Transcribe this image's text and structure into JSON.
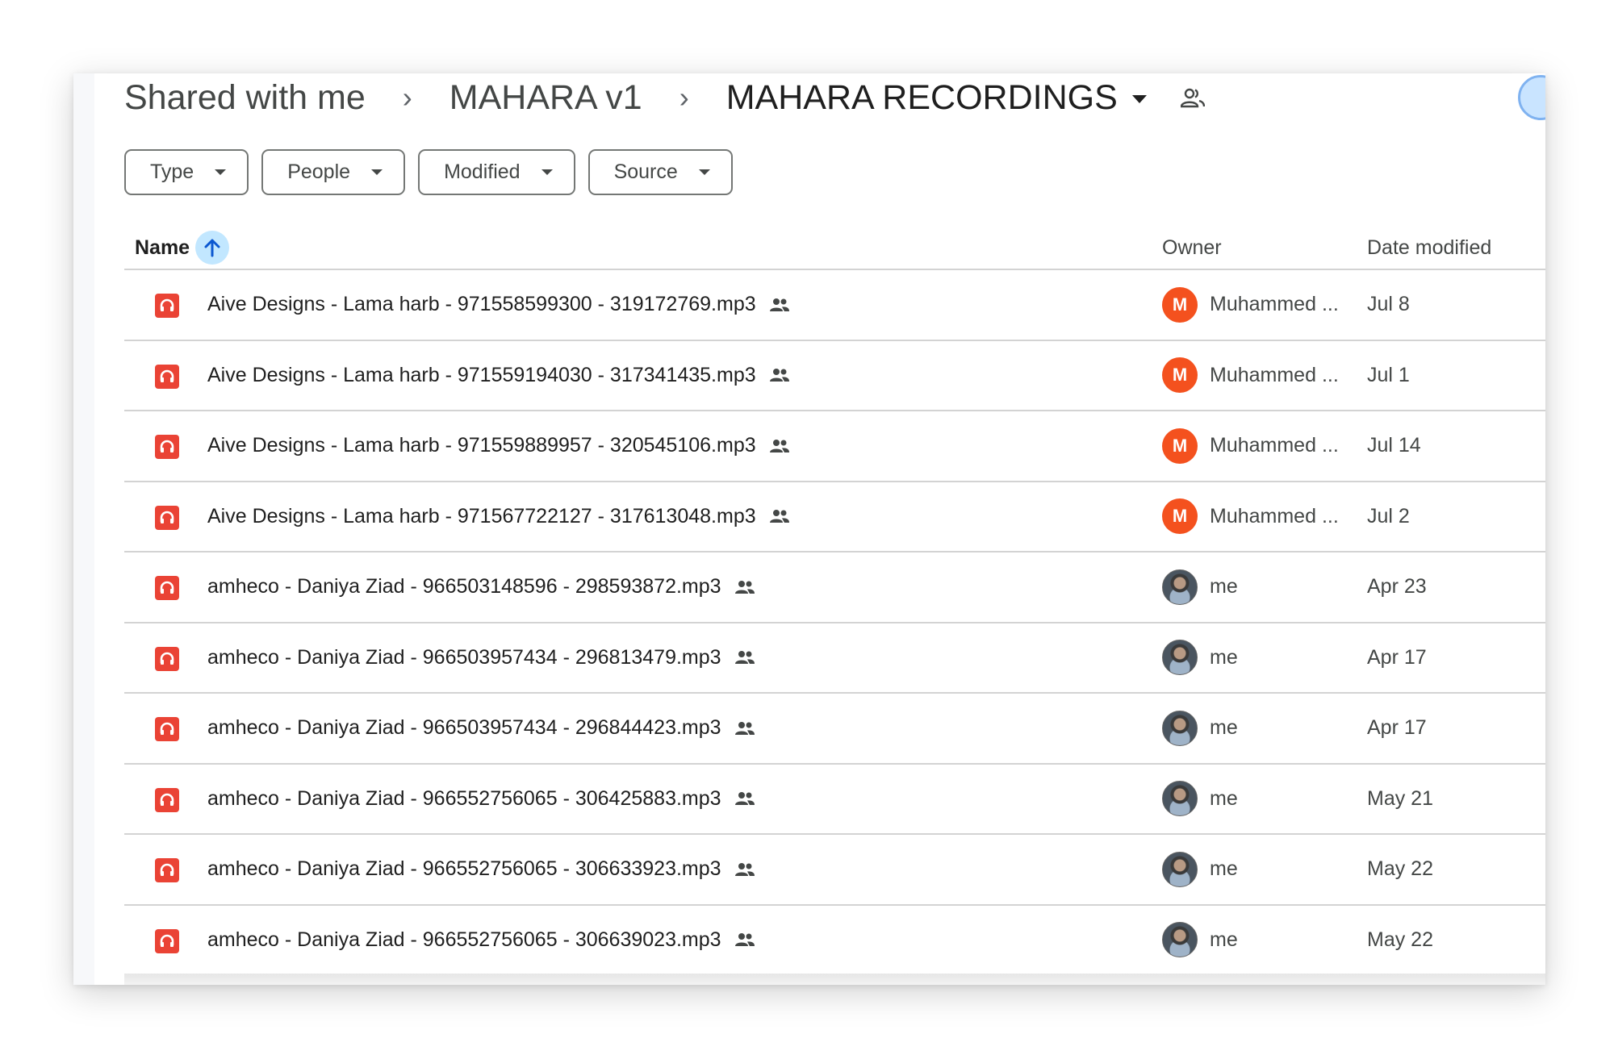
{
  "breadcrumb": {
    "items": [
      "Shared with me",
      "MAHARA v1",
      "MAHARA RECORDINGS"
    ],
    "separator": "›"
  },
  "filters": [
    "Type",
    "People",
    "Modified",
    "Source"
  ],
  "table": {
    "columns": {
      "name": "Name",
      "owner": "Owner",
      "date": "Date modified"
    },
    "sort": "ascending",
    "rows": [
      {
        "name": "Aive Designs - Lama harb - 971558599300 - 319172769.mp3",
        "owner": "Muhammed ...",
        "owner_initial": "M",
        "avatar": "letter",
        "date": "Jul 8"
      },
      {
        "name": "Aive Designs - Lama harb - 971559194030 - 317341435.mp3",
        "owner": "Muhammed ...",
        "owner_initial": "M",
        "avatar": "letter",
        "date": "Jul 1"
      },
      {
        "name": "Aive Designs - Lama harb - 971559889957 - 320545106.mp3",
        "owner": "Muhammed ...",
        "owner_initial": "M",
        "avatar": "letter",
        "date": "Jul 14"
      },
      {
        "name": "Aive Designs - Lama harb - 971567722127 - 317613048.mp3",
        "owner": "Muhammed ...",
        "owner_initial": "M",
        "avatar": "letter",
        "date": "Jul 2"
      },
      {
        "name": "amheco - Daniya Ziad - 966503148596 - 298593872.mp3",
        "owner": "me",
        "owner_initial": "",
        "avatar": "photo",
        "date": "Apr 23"
      },
      {
        "name": "amheco - Daniya Ziad - 966503957434 - 296813479.mp3",
        "owner": "me",
        "owner_initial": "",
        "avatar": "photo",
        "date": "Apr 17"
      },
      {
        "name": "amheco - Daniya Ziad - 966503957434 - 296844423.mp3",
        "owner": "me",
        "owner_initial": "",
        "avatar": "photo",
        "date": "Apr 17"
      },
      {
        "name": "amheco - Daniya Ziad - 966552756065 - 306425883.mp3",
        "owner": "me",
        "owner_initial": "",
        "avatar": "photo",
        "date": "May 21"
      },
      {
        "name": "amheco - Daniya Ziad - 966552756065 - 306633923.mp3",
        "owner": "me",
        "owner_initial": "",
        "avatar": "photo",
        "date": "May 22"
      },
      {
        "name": "amheco - Daniya Ziad - 966552756065 - 306639023.mp3",
        "owner": "me",
        "owner_initial": "",
        "avatar": "photo",
        "date": "May 22"
      }
    ]
  },
  "colors": {
    "audio_file_icon": "#ea4335",
    "owner_letter_avatar": "#f4511e",
    "sort_button_bg": "#c2e7ff",
    "sort_arrow": "#0b57d0"
  },
  "icons": {
    "file": "audio-headphones-icon",
    "shared": "shared-people-icon",
    "sort": "arrow-up-icon",
    "folder_shared": "shared-folder-people-icon"
  }
}
